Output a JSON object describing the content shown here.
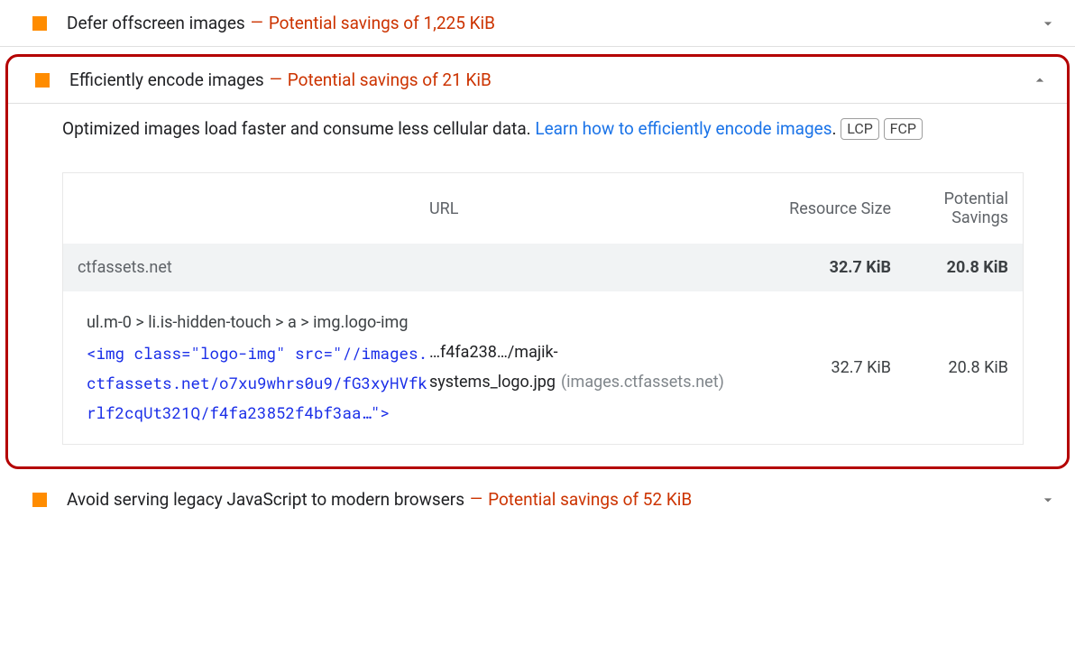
{
  "audits": {
    "defer": {
      "title": "Defer offscreen images",
      "savings": "Potential savings of 1,225 KiB"
    },
    "encode": {
      "title": "Efficiently encode images",
      "savings": "Potential savings of 21 KiB",
      "description_prefix": "Optimized images load faster and consume less cellular data. ",
      "learn_link": "Learn how to efficiently encode images",
      "period": ".",
      "badge_lcp": "LCP",
      "badge_fcp": "FCP",
      "table": {
        "headers": {
          "url": "URL",
          "resource": "Resource Size",
          "savings": "Potential Savings"
        },
        "group": {
          "name": "ctfassets.net",
          "resource": "32.7 KiB",
          "savings": "20.8 KiB"
        },
        "row": {
          "selector": "ul.m-0 > li.is-hidden-touch > a > img.logo-img",
          "snippet": "<img class=\"logo-img\" src=\"//images.ctfassets.net/o7xu9whrs0u9/fG3xyHVfkrlf2cqUt321Q/f4fa23852f4bf3aa…\">",
          "url_main": "…f4fa238…/majik-systems_logo.jpg",
          "url_host": "(images.ctfassets.net)",
          "resource": "32.7 KiB",
          "savings": "20.8 KiB"
        }
      }
    },
    "legacy": {
      "title": "Avoid serving legacy JavaScript to modern browsers",
      "savings": "Potential savings of 52 KiB"
    }
  },
  "dash": "—"
}
